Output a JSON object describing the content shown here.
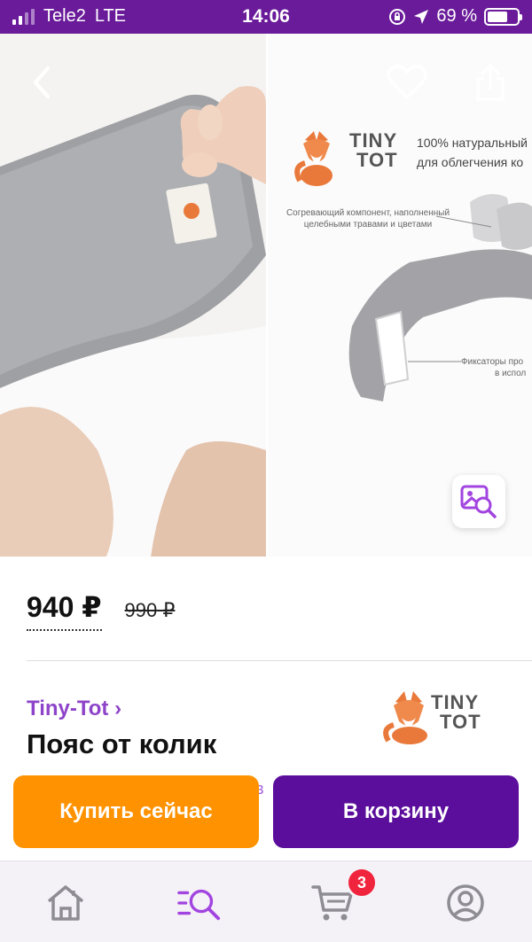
{
  "status_bar": {
    "carrier": "Tele2",
    "network": "LTE",
    "time": "14:06",
    "battery_percent": "69 %",
    "battery_level": 0.69
  },
  "gallery": {
    "back_icon": "chevron-left-icon",
    "favorite_icon": "heart-icon",
    "share_icon": "share-icon",
    "zoom_icon": "image-search-icon",
    "promo": {
      "logo_line1": "TINY",
      "logo_line2": "TOT",
      "headline_line1": "100% натуральный",
      "headline_line2": "для облегчения ко",
      "callout1_line1": "Согревающий компонент, наполненный",
      "callout1_line2": "целебными травами и цветами",
      "callout2_line1": "Фиксаторы про",
      "callout2_line2": "в испол"
    }
  },
  "product": {
    "price": "940 ₽",
    "old_price": "990 ₽",
    "brand": "Tiny-Tot ›",
    "title": "Пояс от колик",
    "brand_logo_line1": "TINY",
    "brand_logo_line2": "TOT",
    "peek_text": "в"
  },
  "actions": {
    "buy_now": "Купить сейчас",
    "add_to_cart": "В корзину",
    "buy_color": "#fe9200",
    "cart_color": "#5b0e9b"
  },
  "tabbar": {
    "home_icon": "home-icon",
    "catalog_icon": "catalog-search-icon",
    "cart_icon": "cart-icon",
    "cart_badge": "3",
    "profile_icon": "profile-icon",
    "active_color": "#a245e0"
  }
}
